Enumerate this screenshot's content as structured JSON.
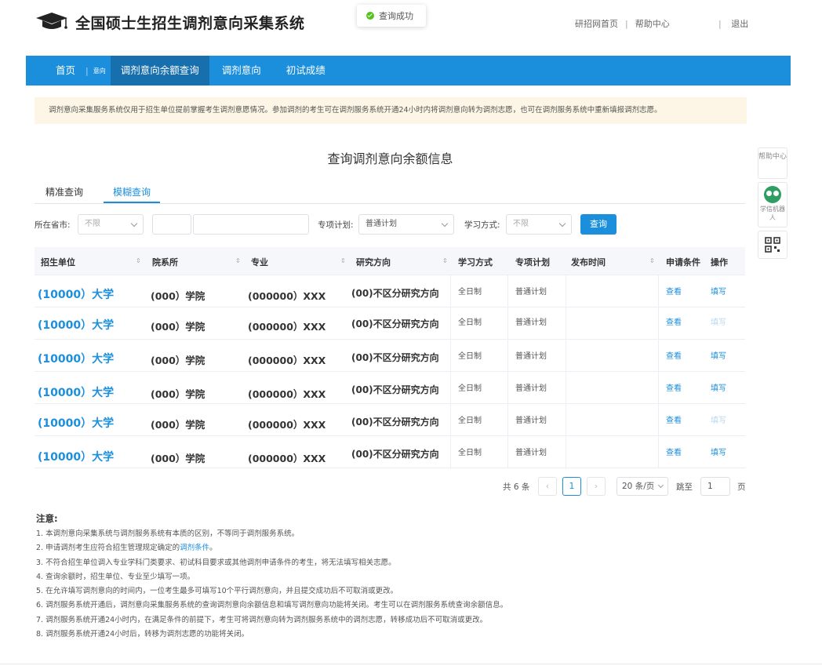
{
  "header": {
    "title": "全国硕士生招生调剂意向采集系统",
    "toast": "查询成功",
    "links": [
      "研招网首页",
      "帮助中心"
    ],
    "link_sep": "|",
    "logout": "退出"
  },
  "nav": {
    "items": [
      "首页",
      "意向",
      "调剂意向余额查询",
      "调剂意向",
      "初试成绩"
    ],
    "sep": "|"
  },
  "notice": "调剂意向采集服务系统仅用于招生单位提前掌握考生调剂意愿情况。参加调剂的考生可在调剂服务系统开通24小时内将调剂意向转为调剂志愿，也可在调剂服务系统中重新填报调剂志愿。",
  "page_title": "查询调剂意向余额信息",
  "tabs": [
    "精准查询",
    "模糊查询"
  ],
  "filters": {
    "province_label": "所在省市:",
    "province_value": "不限",
    "keyword_value": "",
    "plan_label": "专项计划:",
    "plan_value": "普通计划",
    "mode_label": "学习方式:",
    "mode_value": "不限",
    "search_button": "查询"
  },
  "table": {
    "headers": [
      "招生单位",
      "院系所",
      "专业",
      "研究方向",
      "学习方式",
      "专项计划",
      "发布时间",
      "申请条件",
      "操作"
    ],
    "sort_icon": "⇕",
    "rows": [
      {
        "school": "(10000）大学",
        "dept": "(000）学院",
        "major": "(000000）XXX",
        "direction": "(00)不区分研究方向",
        "mode": "全日制",
        "plan": "普通计划",
        "time": "",
        "view": "查看",
        "fill": "填写",
        "fill_enabled": true
      },
      {
        "school": "(10000）大学",
        "dept": "(000）学院",
        "major": "(000000）XXX",
        "direction": "(00)不区分研究方向",
        "mode": "全日制",
        "plan": "普通计划",
        "time": "",
        "view": "查看",
        "fill": "填写",
        "fill_enabled": false
      },
      {
        "school": "(10000）大学",
        "dept": "(000）学院",
        "major": "(000000）XXX",
        "direction": "(00)不区分研究方向",
        "mode": "全日制",
        "plan": "普通计划",
        "time": "",
        "view": "查看",
        "fill": "填写",
        "fill_enabled": true
      },
      {
        "school": "(10000）大学",
        "dept": "(000）学院",
        "major": "(000000）XXX",
        "direction": "(00)不区分研究方向",
        "mode": "全日制",
        "plan": "普通计划",
        "time": "",
        "view": "查看",
        "fill": "填写",
        "fill_enabled": true
      },
      {
        "school": "(10000）大学",
        "dept": "(000）学院",
        "major": "(000000）XXX",
        "direction": "(00)不区分研究方向",
        "mode": "全日制",
        "plan": "普通计划",
        "time": "",
        "view": "查看",
        "fill": "填写",
        "fill_enabled": false
      },
      {
        "school": "(10000）大学",
        "dept": "(000）学院",
        "major": "(000000）XXX",
        "direction": "(00)不区分研究方向",
        "mode": "全日制",
        "plan": "普通计划",
        "time": "",
        "view": "查看",
        "fill": "填写",
        "fill_enabled": true
      }
    ]
  },
  "pagination": {
    "total": "共 6 条",
    "prev": "‹",
    "current": "1",
    "next": "›",
    "page_size": "20 条/页",
    "goto_label": "跳至",
    "goto_value": "1",
    "unit": "页"
  },
  "notes": {
    "title": "注意:",
    "items": [
      "1. 本调剂意向采集系统与调剂服务系统有本质的区别，不等同于调剂服务系统。",
      "2. 申请调剂考生应符合招生管理规定确定的",
      "3. 不符合招生单位调入专业学科门类要求、初试科目要求或其他调剂申请条件的考生，将无法填写相关志愿。",
      "4. 查询余额时，招生单位、专业至少填写一项。",
      "5. 在允许填写调剂意向的时间内，一位考生最多可填写10个平行调剂意向，并且提交成功后不可取消或更改。",
      "6. 调剂服务系统开通后，调剂意向采集服务系统的查询调剂意向余额信息和填写调剂意向功能将关闭。考生可以在调剂服务系统查询余额信息。",
      "7. 调剂服务系统开通24小时内，在满足条件的前提下，考生可将调剂意向转为调剂服务系统中的调剂志愿，转移成功后不可取消或更改。",
      "8. 调剂服务系统开通24小时后，转移为调剂志愿的功能将关闭。"
    ],
    "link_text": "调剂条件",
    "link_suffix": "。"
  },
  "side": {
    "help": "帮助中心",
    "bot": "学信机器人",
    "qr_icon": "qr-code-icon"
  },
  "colors": {
    "primary": "#1c8fdc",
    "nav_active": "#176fae",
    "notice_bg": "#fdf6e6",
    "success": "#52c41a"
  }
}
